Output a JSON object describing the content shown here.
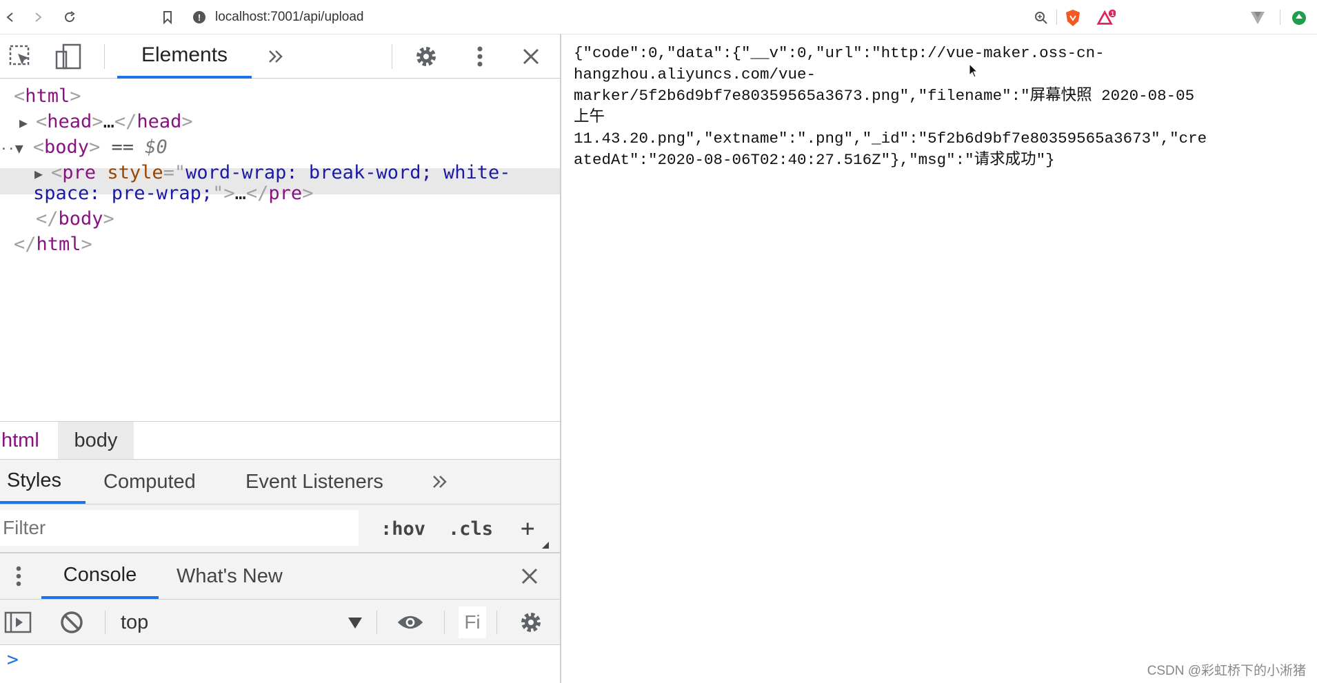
{
  "browser": {
    "url": "localhost:7001/api/upload",
    "notification_count": "1"
  },
  "devtools": {
    "panel_tab": "Elements",
    "dom": {
      "html_open": "html",
      "head_tag": "head",
      "head_ellipsis": "…",
      "body_tag": "body",
      "body_eq": "==",
      "body_ref": "$0",
      "pre_tag": "pre",
      "pre_attr_name": "style",
      "pre_attr_value_line1": "word-wrap: break-word; white-",
      "pre_attr_value_line2": "space: pre-wrap;",
      "pre_ellipsis": "…",
      "body_close": "body",
      "html_close": "html"
    },
    "breadcrumbs": [
      "html",
      "body"
    ],
    "styles_tabs": [
      "Styles",
      "Computed",
      "Event Listeners"
    ],
    "filter": {
      "placeholder": "Filter",
      "hov": ":hov",
      "cls": ".cls",
      "add": "+"
    },
    "drawer_tabs": [
      "Console",
      "What's New"
    ],
    "console": {
      "context": "top",
      "filter_stub": "Fi",
      "prompt": ">"
    }
  },
  "page": {
    "response_text": "{\"code\":0,\"data\":{\"__v\":0,\"url\":\"http://vue-maker.oss-cn-\nhangzhou.aliyuncs.com/vue-\nmarker/5f2b6d9bf7e80359565a3673.png\",\"filename\":\"屏幕快照 2020-08-05\n上午\n11.43.20.png\",\"extname\":\".png\",\"_id\":\"5f2b6d9bf7e80359565a3673\",\"cre\natedAt\":\"2020-08-06T02:40:27.516Z\"},\"msg\":\"请求成功\"}"
  },
  "watermark": "CSDN @彩虹桥下的小淅猪",
  "colors": {
    "accent": "#1a73e8",
    "tag": "#881280",
    "attr": "#994500",
    "attr_value": "#1a1aa6",
    "selection": "#e8e8e8"
  }
}
